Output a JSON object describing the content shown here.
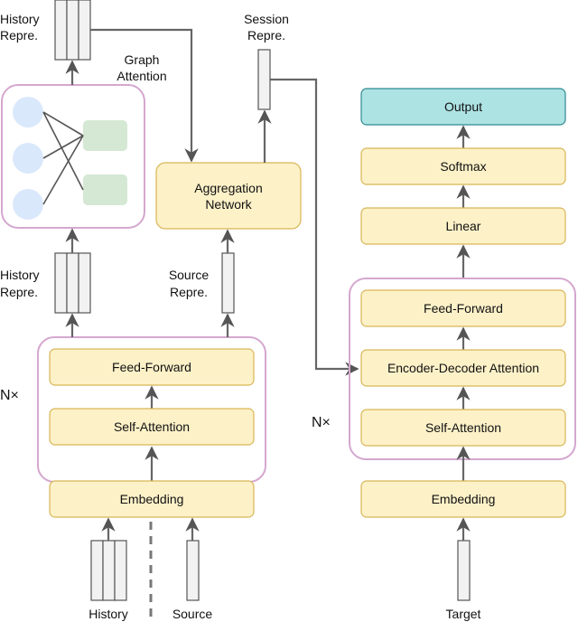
{
  "diagram": {
    "encoder": {
      "repeat_label": "N×",
      "layers": [
        "Feed-Forward",
        "Self-Attention"
      ],
      "embedding": "Embedding",
      "inputs": [
        "History",
        "Source"
      ],
      "history_repr_label_top": [
        "History",
        "Repre."
      ],
      "history_repr_label_mid": [
        "History",
        "Repre."
      ],
      "source_repr_label": [
        "Source",
        "Repre."
      ],
      "graph_attention_label": [
        "Graph",
        "Attention"
      ],
      "aggregation": [
        "Aggregation",
        "Network"
      ],
      "session_repr_label": [
        "Session",
        "Repre."
      ]
    },
    "decoder": {
      "repeat_label": "N×",
      "output": "Output",
      "softmax": "Softmax",
      "linear": "Linear",
      "layers": [
        "Feed-Forward",
        "Encoder-Decoder Attention",
        "Self-Attention"
      ],
      "embedding": "Embedding",
      "input": "Target"
    },
    "colors": {
      "block_fill": "#fdf1c8",
      "block_stroke": "#d8b656",
      "output_fill": "#aee3e4",
      "group_stroke": "#d5a7cf",
      "graph_node": "#dae8fc",
      "graph_rect": "#d5e8d4"
    }
  }
}
